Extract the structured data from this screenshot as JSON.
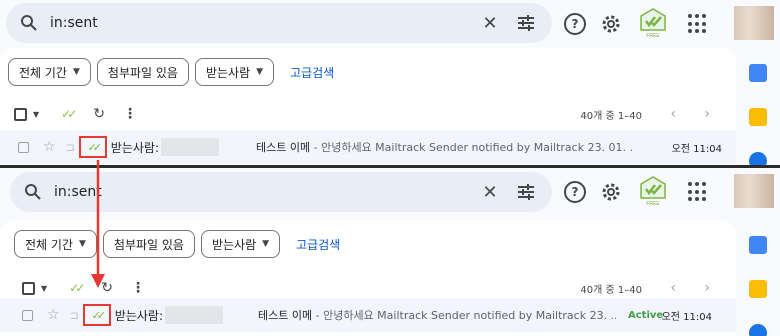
{
  "search": {
    "query": "in:sent"
  },
  "filters": {
    "date_range": "전체 기간",
    "has_attachment": "첨부파일 있음",
    "recipient": "받는사람",
    "advanced_search": "고급검색"
  },
  "pager": "40개 중 1–40",
  "email": {
    "recipient_label": "받는사람:",
    "subject": "테스트 이메",
    "separator": " - ",
    "snippet_top": "안녕하세요 Mailtrack Sender notified by Mailtrack 23. 01. ...",
    "snippet_bottom": "안녕하세요 Mailtrack Sender notified by Mailtrack 23. ...",
    "status": "Active",
    "time": "오전 11:04"
  },
  "icons": {
    "help": "help-icon",
    "settings": "gear-icon",
    "mailtrack": "mailtrack-free-logo",
    "apps": "apps-grid-icon"
  },
  "mailtrack_badge": "FREE",
  "colors": {
    "highlight": "#e53935",
    "mailtrack_green": "#7cb342",
    "link_blue": "#0b57d0"
  }
}
